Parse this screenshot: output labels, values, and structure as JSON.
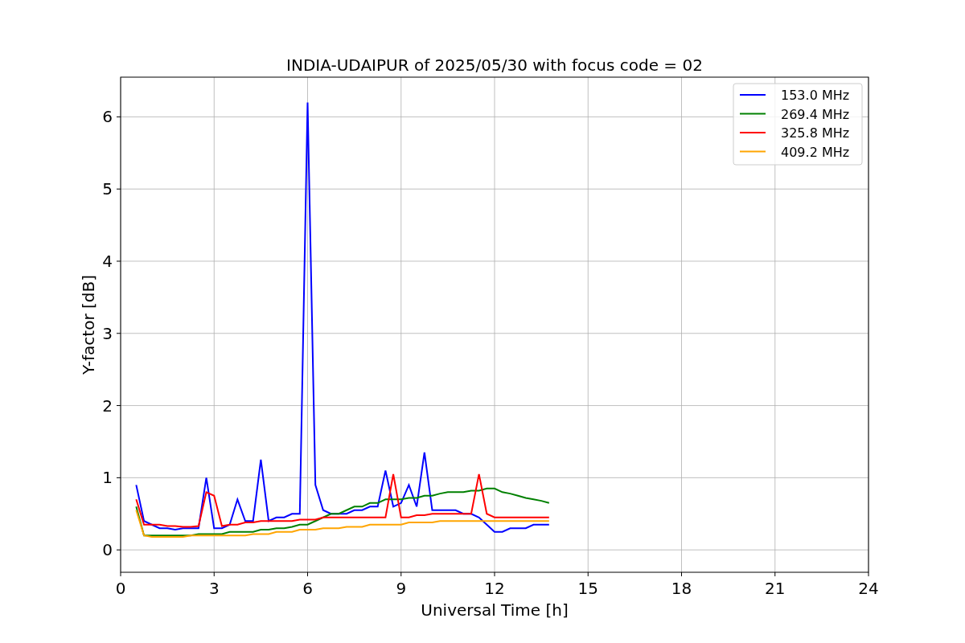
{
  "chart": {
    "chart_data": {
      "type": "line",
      "grid": true,
      "legend": "upper right",
      "title": "INDIA-UDAIPUR of 2025/05/30 with focus code = 02",
      "xlabel": "Universal Time [h]",
      "ylabel": "Y-factor [dB]",
      "xlim": [
        0,
        24
      ],
      "ylim": [
        -0.31,
        6.55
      ],
      "xticks": [
        0,
        3,
        6,
        9,
        12,
        15,
        18,
        21,
        24
      ],
      "yticks": [
        0,
        1,
        2,
        3,
        4,
        5,
        6
      ],
      "x": [
        0.5,
        0.75,
        1,
        1.25,
        1.5,
        1.75,
        2,
        2.25,
        2.5,
        2.75,
        3,
        3.25,
        3.5,
        3.75,
        4,
        4.25,
        4.5,
        4.75,
        5,
        5.25,
        5.5,
        5.75,
        6,
        6.25,
        6.5,
        6.75,
        7,
        7.25,
        7.5,
        7.75,
        8,
        8.25,
        8.5,
        8.75,
        9,
        9.25,
        9.5,
        9.75,
        10,
        10.25,
        10.5,
        10.75,
        11,
        11.25,
        11.5,
        11.75,
        12,
        12.25,
        12.5,
        12.75,
        13,
        13.25,
        13.5,
        13.75
      ],
      "series": [
        {
          "name": "153.0 MHz",
          "color": "#0000ff",
          "values": [
            0.9,
            0.4,
            0.35,
            0.3,
            0.3,
            0.28,
            0.3,
            0.3,
            0.3,
            1.0,
            0.3,
            0.3,
            0.35,
            0.7,
            0.4,
            0.4,
            1.25,
            0.4,
            0.45,
            0.45,
            0.5,
            0.5,
            6.2,
            0.9,
            0.55,
            0.5,
            0.5,
            0.5,
            0.55,
            0.55,
            0.6,
            0.6,
            1.1,
            0.6,
            0.65,
            0.9,
            0.6,
            1.35,
            0.55,
            0.55,
            0.55,
            0.55,
            0.5,
            0.5,
            0.45,
            0.35,
            0.25,
            0.25,
            0.3,
            0.3,
            0.3,
            0.35,
            0.35,
            0.35
          ]
        },
        {
          "name": "269.4 MHz",
          "color": "#008000",
          "values": [
            0.6,
            0.2,
            0.2,
            0.2,
            0.2,
            0.2,
            0.2,
            0.2,
            0.22,
            0.22,
            0.22,
            0.22,
            0.25,
            0.25,
            0.25,
            0.25,
            0.28,
            0.28,
            0.3,
            0.3,
            0.32,
            0.35,
            0.35,
            0.4,
            0.45,
            0.5,
            0.5,
            0.55,
            0.6,
            0.6,
            0.65,
            0.65,
            0.7,
            0.7,
            0.7,
            0.72,
            0.72,
            0.75,
            0.75,
            0.78,
            0.8,
            0.8,
            0.8,
            0.82,
            0.82,
            0.85,
            0.85,
            0.8,
            0.78,
            0.75,
            0.72,
            0.7,
            0.68,
            0.65
          ]
        },
        {
          "name": "325.8 MHz",
          "color": "#ff0000",
          "values": [
            0.7,
            0.35,
            0.35,
            0.35,
            0.33,
            0.33,
            0.32,
            0.32,
            0.33,
            0.8,
            0.75,
            0.33,
            0.35,
            0.35,
            0.38,
            0.38,
            0.4,
            0.4,
            0.4,
            0.4,
            0.4,
            0.42,
            0.42,
            0.42,
            0.45,
            0.45,
            0.45,
            0.45,
            0.45,
            0.45,
            0.45,
            0.45,
            0.45,
            1.05,
            0.45,
            0.45,
            0.48,
            0.48,
            0.5,
            0.5,
            0.5,
            0.5,
            0.5,
            0.5,
            1.05,
            0.5,
            0.45,
            0.45,
            0.45,
            0.45,
            0.45,
            0.45,
            0.45,
            0.45
          ]
        },
        {
          "name": "409.2 MHz",
          "color": "#ffa500",
          "values": [
            0.55,
            0.2,
            0.18,
            0.18,
            0.18,
            0.18,
            0.18,
            0.2,
            0.2,
            0.2,
            0.2,
            0.2,
            0.2,
            0.2,
            0.2,
            0.22,
            0.22,
            0.22,
            0.25,
            0.25,
            0.25,
            0.28,
            0.28,
            0.28,
            0.3,
            0.3,
            0.3,
            0.32,
            0.32,
            0.32,
            0.35,
            0.35,
            0.35,
            0.35,
            0.35,
            0.38,
            0.38,
            0.38,
            0.38,
            0.4,
            0.4,
            0.4,
            0.4,
            0.4,
            0.4,
            0.4,
            0.4,
            0.4,
            0.4,
            0.4,
            0.4,
            0.4,
            0.4,
            0.4
          ]
        }
      ]
    }
  }
}
